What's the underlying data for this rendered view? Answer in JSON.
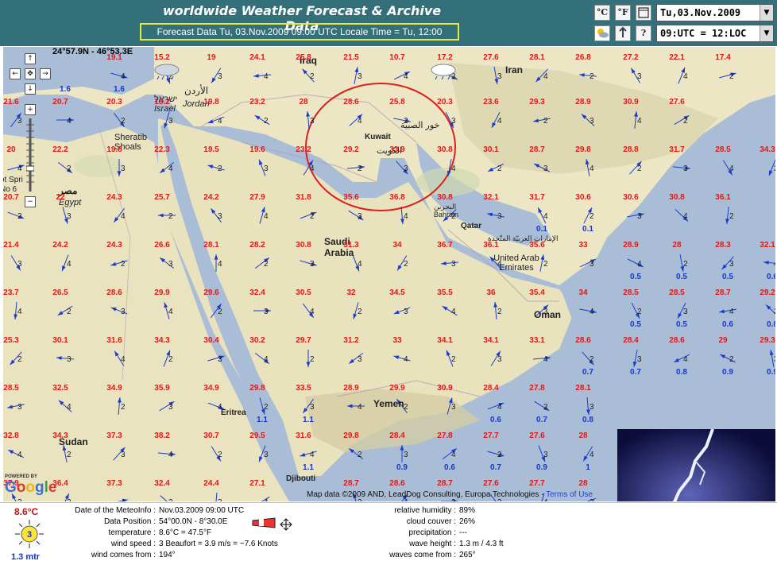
{
  "header": {
    "title": "worldwide Weather Forecast & Archive Data",
    "subtitle": "Forecast Data Tu, 03.Nov.2009 09:00 UTC Locale Time = Tu, 12:00",
    "btn_celsius": "°C",
    "btn_fahrenheit": "°F",
    "btn_help": "?",
    "date_select": "Tu,03.Nov.2009",
    "time_select": "09:UTC = 12:LOC"
  },
  "map": {
    "coordinate_readout": "24°57.9N - 46°53.3E",
    "copyright": "Map data ©2009 AND, LeadDog Consulting, Europa Technologies - ",
    "terms": "Terms of Use",
    "powered_by": "POWERED BY",
    "google": "Google",
    "places": {
      "iraq": "Iraq",
      "iran": "Iran",
      "jordan_ar": "الأردن",
      "jordan": "Jordan",
      "israel_he": "ישראל",
      "israel": "Israel",
      "kuwait": "Kuwait",
      "kuwait_ar": "الكويت",
      "bahrain_ar": "البحرين",
      "bahrain": "Bahrain",
      "qatar": "Qatar",
      "uae_ar": "الإمارات العربيّة المتّحدة",
      "uae": "United Arab Emirates",
      "saudi": "Saudi Arabia",
      "oman": "Oman",
      "yemen": "Yemen",
      "eritrea": "Eritrea",
      "sudan": "Sudan",
      "djibouti": "Djibouti",
      "egypt_ar": "مصر",
      "egypt": "Egypt",
      "sheratib": "Sheratib Shoals",
      "gulf_ar": "خور الصبية",
      "spring": "ot Spri No 6"
    },
    "rows_y": [
      8,
      64,
      124,
      184,
      244,
      304,
      364,
      424,
      484,
      544
    ],
    "cols_x": [
      10,
      72,
      140,
      200,
      262,
      320,
      378,
      438,
      496,
      556,
      614,
      672,
      730,
      790,
      848,
      906,
      962
    ],
    "temps": [
      [
        "",
        "",
        "19.1",
        "15.2",
        "19",
        "24.1",
        "25.8",
        "21.5",
        "10.7",
        "17.2",
        "27.6",
        "28.1",
        "26.8",
        "27.2",
        "22.1",
        "17.4",
        ""
      ],
      [
        "21.6",
        "20.7",
        "20.3",
        "18.2",
        "19.8",
        "23.2",
        "28",
        "28.6",
        "25.8",
        "20.3",
        "23.6",
        "29.3",
        "28.9",
        "30.9",
        "27.6",
        "",
        ""
      ],
      [
        "20",
        "22.2",
        "19.8",
        "22.3",
        "19.5",
        "19.6",
        "23.2",
        "29.2",
        "33.9",
        "30.8",
        "30.1",
        "28.7",
        "29.8",
        "28.8",
        "31.7",
        "28.5",
        "34.3"
      ],
      [
        "20.7",
        "22",
        "24.3",
        "25.7",
        "24.2",
        "27.9",
        "31.8",
        "35.6",
        "36.8",
        "30.8",
        "32.1",
        "31.7",
        "30.6",
        "30.6",
        "30.8",
        "36.1",
        ""
      ],
      [
        "21.4",
        "24.2",
        "24.3",
        "26.6",
        "28.1",
        "28.2",
        "30.8",
        "31.3",
        "34",
        "36.7",
        "36.1",
        "35.6",
        "33",
        "28.9",
        "28",
        "28.3",
        "32.1"
      ],
      [
        "23.7",
        "26.5",
        "28.6",
        "29.9",
        "29.6",
        "32.4",
        "30.5",
        "32",
        "34.5",
        "35.5",
        "36",
        "35.4",
        "34",
        "28.5",
        "28.5",
        "28.7",
        "29.2"
      ],
      [
        "25.3",
        "30.1",
        "31.6",
        "34.3",
        "30.4",
        "30.2",
        "29.7",
        "31.2",
        "33",
        "34.1",
        "34.1",
        "33.1",
        "28.6",
        "28.4",
        "28.6",
        "29",
        "29.3"
      ],
      [
        "28.5",
        "32.5",
        "34.9",
        "35.9",
        "34.9",
        "29.8",
        "33.5",
        "28.9",
        "29.9",
        "30.9",
        "28.4",
        "27.8",
        "28.1",
        "",
        "",
        "",
        ""
      ],
      [
        "32.8",
        "34.3",
        "37.3",
        "38.2",
        "30.7",
        "29.5",
        "31.6",
        "29.8",
        "28.4",
        "27.8",
        "27.7",
        "27.6",
        "28",
        "",
        "",
        "",
        ""
      ],
      [
        "37.9",
        "36.4",
        "37.3",
        "32.4",
        "24.4",
        "27.1",
        "",
        "28.7",
        "28.6",
        "28.7",
        "27.6",
        "27.7",
        "28",
        "",
        "",
        "",
        ""
      ]
    ],
    "waves": [
      {
        "v": "1.6",
        "c": 1,
        "r": 0
      },
      {
        "v": "1.6",
        "c": 2,
        "r": 0
      },
      {
        "v": "0.1",
        "c": 11,
        "r": 3
      },
      {
        "v": "0.1",
        "c": 12,
        "r": 3
      },
      {
        "v": "0.5",
        "c": 13,
        "r": 4
      },
      {
        "v": "0.5",
        "c": 14,
        "r": 4
      },
      {
        "v": "0.5",
        "c": 15,
        "r": 4
      },
      {
        "v": "0.6",
        "c": 16,
        "r": 4
      },
      {
        "v": "0.5",
        "c": 13,
        "r": 5
      },
      {
        "v": "0.5",
        "c": 14,
        "r": 5
      },
      {
        "v": "0.6",
        "c": 15,
        "r": 5
      },
      {
        "v": "0.8",
        "c": 16,
        "r": 5
      },
      {
        "v": "0.7",
        "c": 12,
        "r": 6
      },
      {
        "v": "0.7",
        "c": 13,
        "r": 6
      },
      {
        "v": "0.8",
        "c": 14,
        "r": 6
      },
      {
        "v": "0.9",
        "c": 15,
        "r": 6
      },
      {
        "v": "0.9",
        "c": 16,
        "r": 6
      },
      {
        "v": "1.1",
        "c": 5,
        "r": 7
      },
      {
        "v": "1.1",
        "c": 6,
        "r": 7
      },
      {
        "v": "0.6",
        "c": 10,
        "r": 7
      },
      {
        "v": "0.7",
        "c": 11,
        "r": 7
      },
      {
        "v": "0.8",
        "c": 12,
        "r": 7
      },
      {
        "v": "1.1",
        "c": 6,
        "r": 8
      },
      {
        "v": "0.9",
        "c": 8,
        "r": 8
      },
      {
        "v": "0.6",
        "c": 9,
        "r": 8
      },
      {
        "v": "0.7",
        "c": 10,
        "r": 8
      },
      {
        "v": "0.9",
        "c": 11,
        "r": 8
      },
      {
        "v": "1",
        "c": 12,
        "r": 8
      }
    ]
  },
  "info": {
    "big_temp": "8.6°C",
    "big_wave": "1.3 mtr",
    "sun_number": "3",
    "left": [
      {
        "label": "Date of the MeteoInfo :",
        "value": "Nov.03.2009 09:00 UTC"
      },
      {
        "label": "Data Position :",
        "value": "54°00.0N - 8°30.0E"
      },
      {
        "label": "temperature :",
        "value": "8.6°C = 47.5°F"
      },
      {
        "label": "wind speed :",
        "value": "3 Beaufort = 3.9 m/s = ~7.6 Knots"
      },
      {
        "label": "wind comes from :",
        "value": "194°"
      }
    ],
    "right": [
      {
        "label": "relative humidity :",
        "value": "89%"
      },
      {
        "label": "cloud couver :",
        "value": "26%"
      },
      {
        "label": "precipitation :",
        "value": "---"
      },
      {
        "label": "wave height :",
        "value": "1.3 m / 4.3 ft"
      },
      {
        "label": "waves come from :",
        "value": "265°"
      }
    ]
  },
  "colors": {
    "header_bg": "#34707a",
    "temp_red": "#e01818",
    "wave_blue": "#1a36c8",
    "arrow_blue": "#1a3ad0",
    "highlight_circle": "#dd1f1f"
  }
}
